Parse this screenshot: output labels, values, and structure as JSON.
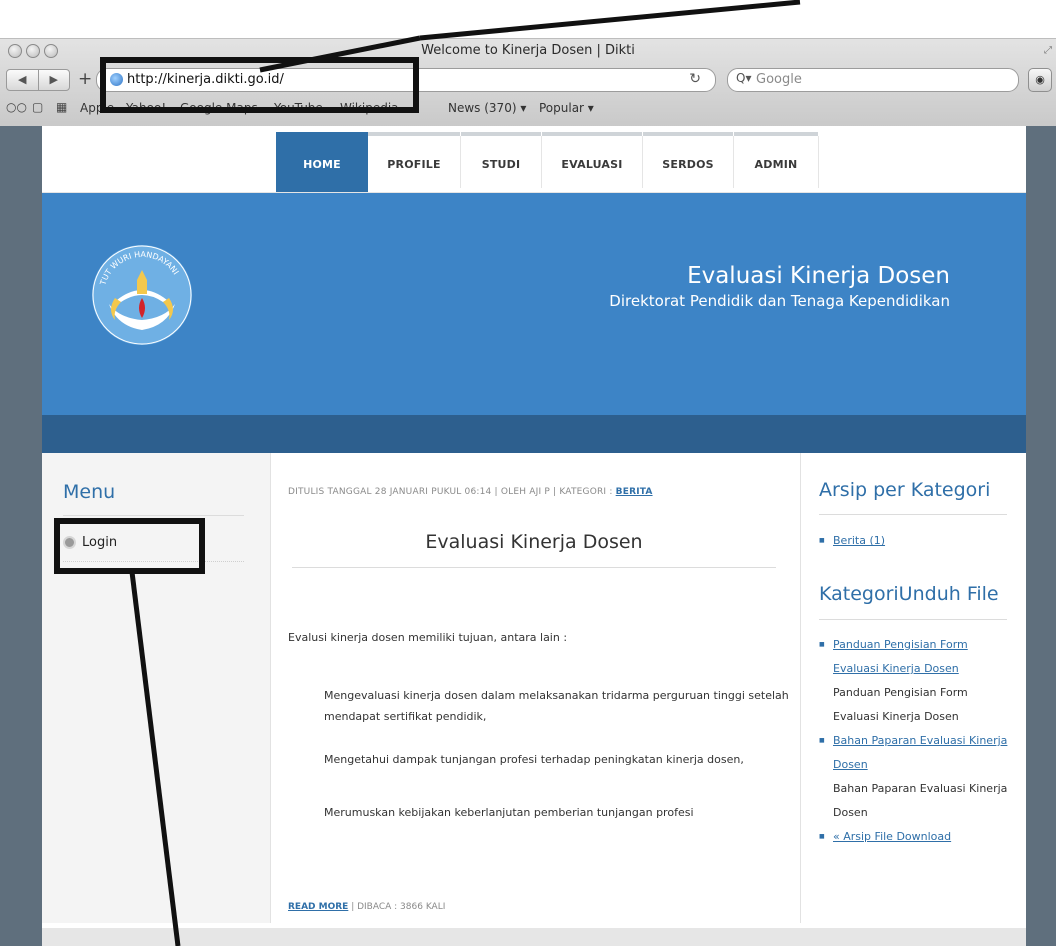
{
  "browser": {
    "window_title": "Welcome to Kinerja Dosen | Dikti",
    "url": "http://kinerja.dikti.go.id/",
    "search_placeholder": "Google",
    "bookmarks": [
      "Apple",
      "Yahoo!",
      "Google Maps",
      "YouTube",
      "Wikipedia",
      "News (370) ▾",
      "Popular ▾"
    ]
  },
  "nav": {
    "tabs": [
      "HOME",
      "PROFILE",
      "STUDI",
      "EVALUASI",
      "SERDOS",
      "ADMIN"
    ],
    "active": "HOME"
  },
  "banner": {
    "title": "Evaluasi Kinerja Dosen",
    "subtitle": "Direktorat Pendidik dan Tenaga Kependidikan",
    "logo_text": "TUT WURI HANDAYANI"
  },
  "sidebar": {
    "title": "Menu",
    "items": [
      "Login"
    ]
  },
  "article": {
    "meta_prefix": "DITULIS TANGGAL 28 JANUARI PUKUL 06:14  |  OLEH AJI P  |  KATEGORI : ",
    "meta_category": "BERITA",
    "title": "Evaluasi Kinerja Dosen",
    "intro": "Evalusi kinerja dosen memiliki tujuan, antara lain :",
    "points": [
      "Mengevaluasi kinerja dosen dalam melaksanakan tridarma perguruan tinggi setelah mendapat sertifikat pendidik,",
      "Mengetahui dampak tunjangan profesi terhadap peningkatan kinerja dosen,",
      "Merumuskan kebijakan keberlanjutan pemberian tunjangan profesi"
    ],
    "read_more": "READ MORE",
    "views": "  |  DIBACA : 3866 KALI"
  },
  "right": {
    "archive_title": "Arsip per Kategori",
    "archive_items": [
      "Berita (1)"
    ],
    "download_title": "KategoriUnduh File",
    "downloads": [
      {
        "link": "Panduan Pengisian Form Evaluasi Kinerja Dosen",
        "desc": "Panduan Pengisian Form Evaluasi Kinerja Dosen"
      },
      {
        "link": "Bahan Paparan Evaluasi Kinerja Dosen",
        "desc": "Bahan Paparan Evaluasi Kinerja Dosen"
      }
    ],
    "archive_link": "« Arsip File Download"
  },
  "colors": {
    "brand_blue": "#3d84c6",
    "nav_active": "#2f6fa8",
    "strip": "#2d5f8e",
    "annotation": "#111111"
  }
}
